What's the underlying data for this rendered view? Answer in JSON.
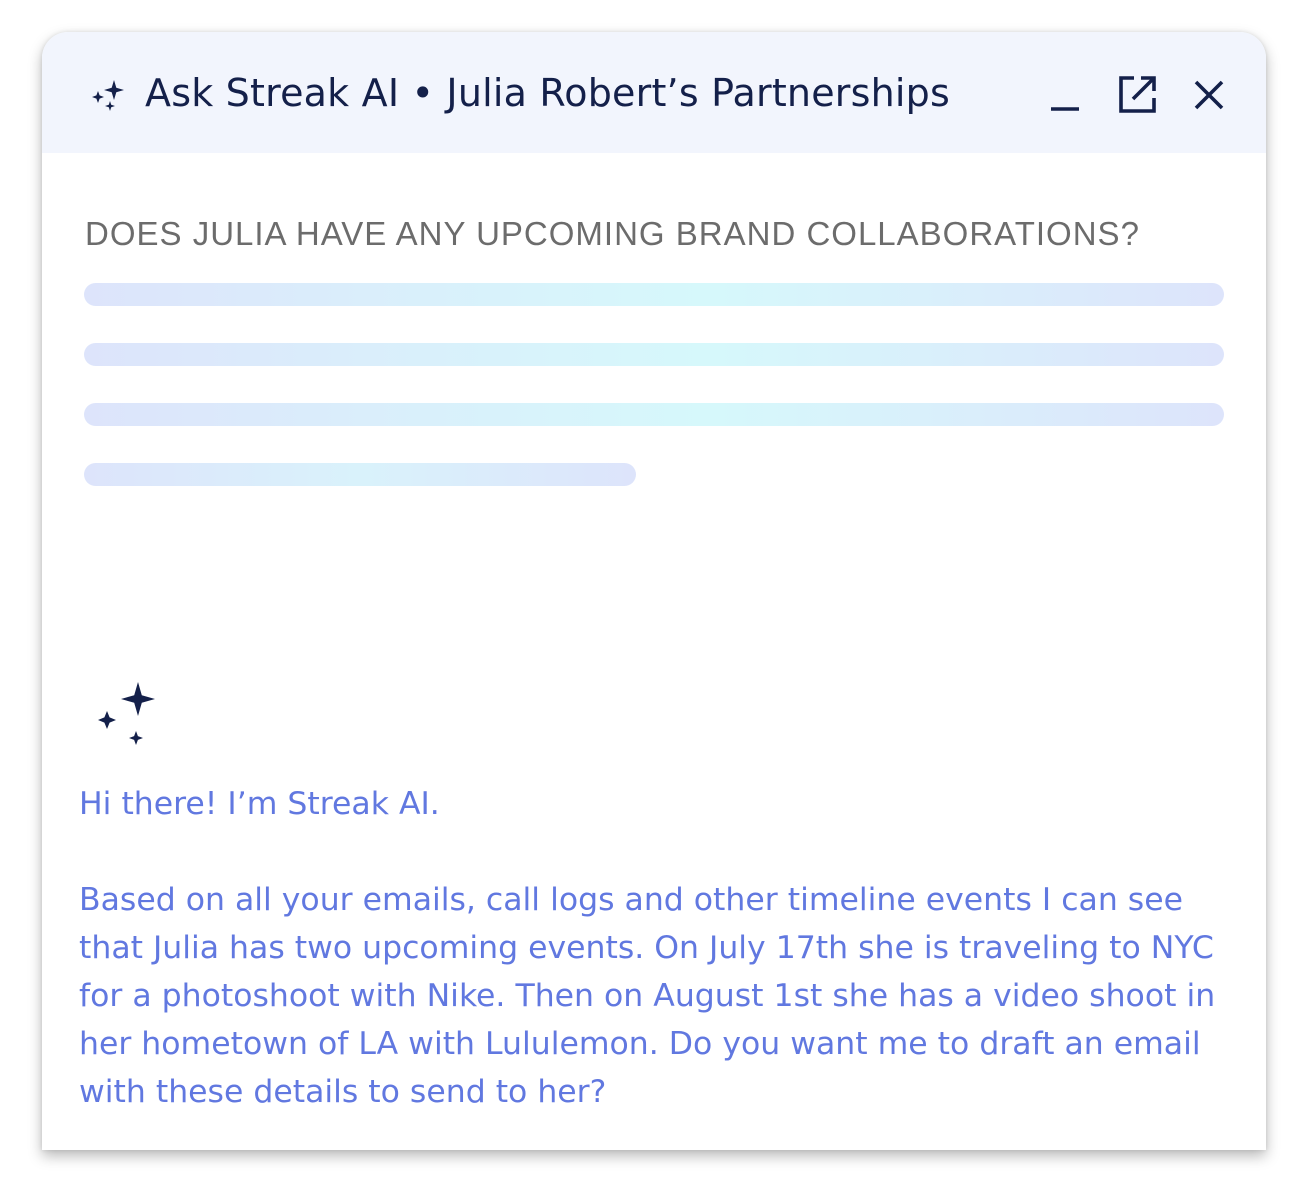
{
  "header": {
    "title": "Ask Streak AI • Julia Robert’s Partnerships",
    "icons": {
      "sparkle": "sparkle-icon",
      "minimize": "minimize-icon",
      "popout": "open-in-new-icon",
      "close": "close-icon"
    }
  },
  "question": {
    "text": "DOES JULIA HAVE ANY UPCOMING BRAND COLLABORATIONS?"
  },
  "answer": {
    "icon": "sparkle-icon",
    "greeting": "Hi there! I’m Streak AI.",
    "body": "Based on all your emails, call logs and other timeline events I can see that Julia has two upcoming events. On July 17th she is traveling to NYC for a photoshoot with Nike. Then on August 1st she has a video shoot in her hometown of LA with Lululemon. Do you want me to draft an email with these details to send to her?"
  },
  "colors": {
    "header_bg": "#f2f5fd",
    "title_text": "#14204a",
    "question_text": "#6c6c6c",
    "answer_text": "#6178e0",
    "skeleton_start": "#dde4fb",
    "skeleton_mid": "#d6f8fb"
  }
}
